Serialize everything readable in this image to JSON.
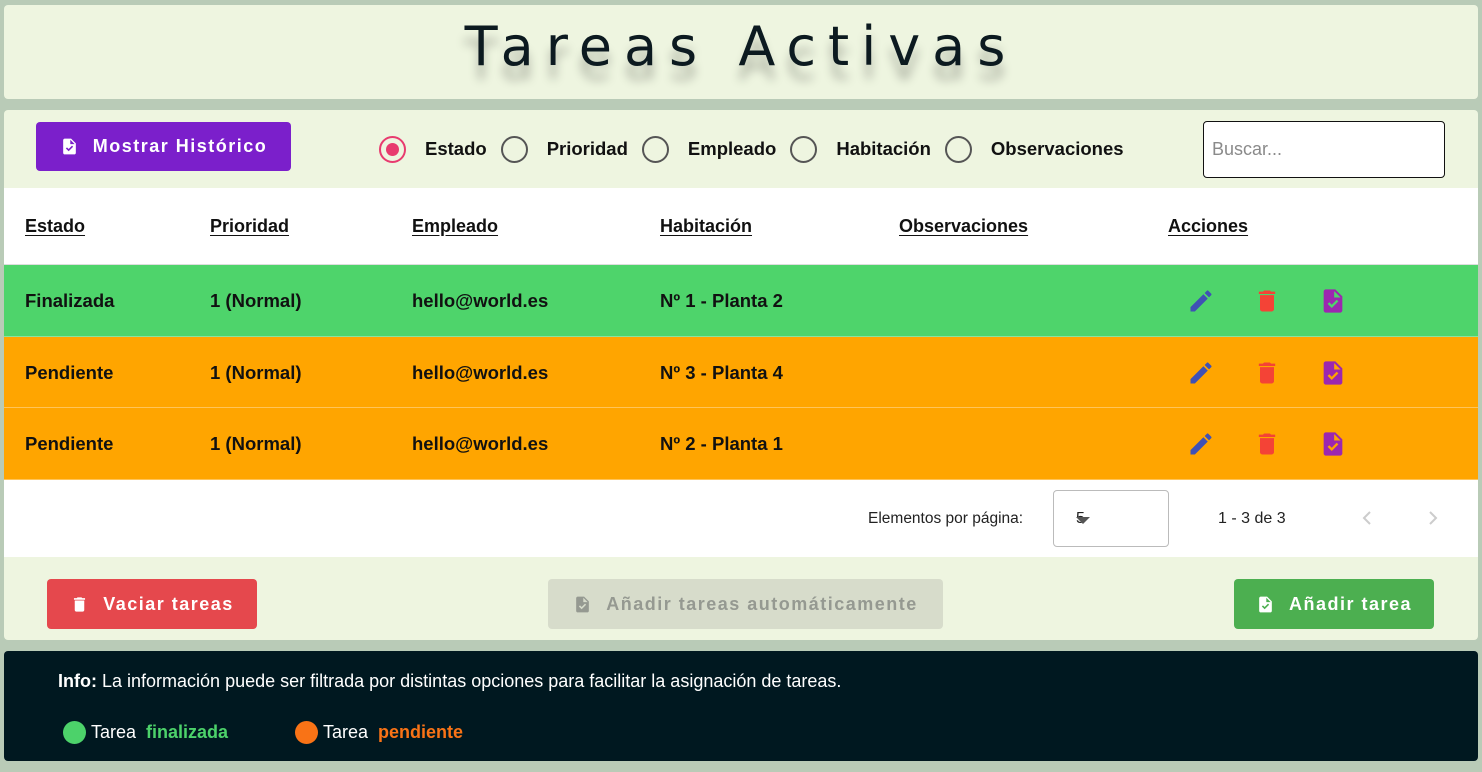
{
  "header": {
    "title": "Tareas Activas"
  },
  "toolbar": {
    "history_button": "Mostrar Histórico",
    "filters": [
      "Estado",
      "Prioridad",
      "Empleado",
      "Habitación",
      "Observaciones"
    ],
    "selected_filter": "Estado",
    "search_placeholder": "Buscar..."
  },
  "table": {
    "columns": [
      "Estado",
      "Prioridad",
      "Empleado",
      "Habitación",
      "Observaciones",
      "Acciones"
    ],
    "rows": [
      {
        "estado": "Finalizada",
        "prioridad": "1 (Normal)",
        "empleado": "hello@world.es",
        "habitacion": "Nº 1 - Planta 2",
        "observaciones": "",
        "status": "done"
      },
      {
        "estado": "Pendiente",
        "prioridad": "1 (Normal)",
        "empleado": "hello@world.es",
        "habitacion": "Nº 3 - Planta 4",
        "observaciones": "",
        "status": "pending"
      },
      {
        "estado": "Pendiente",
        "prioridad": "1 (Normal)",
        "empleado": "hello@world.es",
        "habitacion": "Nº 2 - Planta 1",
        "observaciones": "",
        "status": "pending"
      }
    ],
    "row_actions": [
      "edit-icon",
      "delete-icon",
      "task-done-icon"
    ]
  },
  "paginator": {
    "label": "Elementos por página:",
    "page_size": "5",
    "range": "1 - 3 de 3"
  },
  "footer_buttons": {
    "clear": "Vaciar tareas",
    "auto": "Añadir tareas automáticamente",
    "add": "Añadir tarea"
  },
  "info": {
    "label": "Info:",
    "text": "La información puede ser filtrada por distintas opciones para facilitar la asignación de tareas.",
    "legend": [
      {
        "prefix": "Tarea",
        "word": "finalizada",
        "color": "#4cd26a"
      },
      {
        "prefix": "Tarea",
        "word": "pendiente",
        "color": "#f97316"
      }
    ]
  },
  "colors": {
    "done_row": "#4ed46b",
    "pending_row": "#ffa500",
    "edit_icon": "#3f51b5",
    "delete_icon": "#f44336",
    "done_icon": "#9c27b0",
    "history_button": "#7b1fcb",
    "radio_accent": "#e83b6f"
  }
}
